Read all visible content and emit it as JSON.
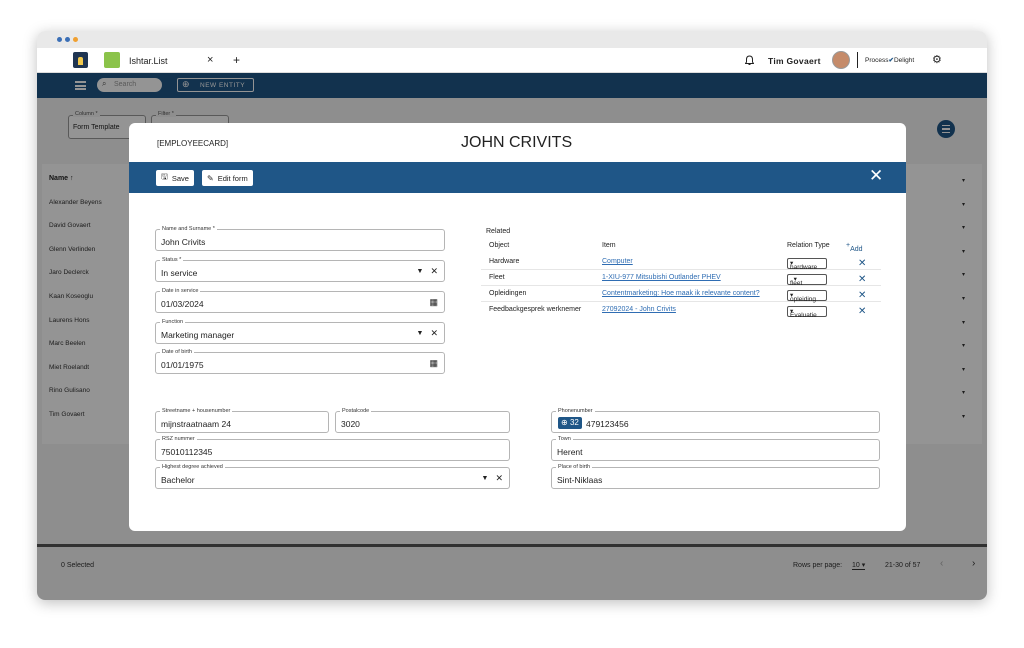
{
  "browser": {
    "tab_title": "Ishtar.List",
    "new_tab": "+",
    "tab_close": "×"
  },
  "header": {
    "user_name": "Tim Govaert",
    "brand_left": "Process",
    "brand_right": "Delight"
  },
  "toolbar": {
    "search_placeholder": "Search",
    "new_entity": "NEW ENTITY"
  },
  "filters": {
    "column_label": "Column *",
    "column_value": "Form Template",
    "filter_label": "Filter *"
  },
  "table": {
    "name_header": "Name ↑",
    "rows": [
      "Alexander Beyens",
      "David Govaert",
      "Glenn Verlinden",
      "Jaro Declerck",
      "Kaan Koseoglu",
      "Laurens Hons",
      "Marc Beelen",
      "Miet Roelandt",
      "Rino Gulisano",
      "Tim Govaert"
    ]
  },
  "footer": {
    "selected": "0 Selected",
    "rows_per_page_label": "Rows per page:",
    "rows_per_page": "10 ▾",
    "range": "21-30 of 57",
    "prev": "‹",
    "next": "›"
  },
  "modal": {
    "tag": "[EMPLOYEECARD]",
    "title": "JOHN CRIVITS",
    "save": "Save",
    "edit_form": "Edit form",
    "fields": {
      "name": {
        "label": "Name and Surname *",
        "value": "John Crivits"
      },
      "status": {
        "label": "Status *",
        "value": "In service"
      },
      "date_in_service": {
        "label": "Date in service",
        "value": "01/03/2024"
      },
      "function": {
        "label": "Function",
        "value": "Marketing manager"
      },
      "dob": {
        "label": "Date of birth",
        "value": "01/01/1975"
      },
      "street": {
        "label": "Streetname + housenumber",
        "value": "mijnstraatnaam 24"
      },
      "postal": {
        "label": "Postalcode",
        "value": "3020"
      },
      "rsz": {
        "label": "RSZ nummer",
        "value": "75010112345"
      },
      "degree": {
        "label": "Highest degree achieved",
        "value": "Bachelor"
      },
      "phone": {
        "label": "Phonenumber",
        "prefix": "32",
        "value": "479123456"
      },
      "town": {
        "label": "Town",
        "value": "Herent"
      },
      "birthplace": {
        "label": "Place of birth",
        "value": "Sint-Niklaas"
      }
    },
    "related": {
      "title": "Related",
      "col_object": "Object",
      "col_item": "Item",
      "col_relation": "Relation Type",
      "add": "Add",
      "rows": [
        {
          "object": "Hardware",
          "item": "Computer",
          "relation": "hardware"
        },
        {
          "object": "Fleet",
          "item": "1-XIU-977 Mitsubishi Outlander PHEV",
          "relation": "fleet"
        },
        {
          "object": "Opleidingen",
          "item": "Contentmarketing: Hoe maak ik relevante content?",
          "relation": "opleiding"
        },
        {
          "object": "Feedbackgesprek werknemer",
          "item": "27092024 - John Crivits",
          "relation": "Evaluatie"
        }
      ]
    }
  }
}
